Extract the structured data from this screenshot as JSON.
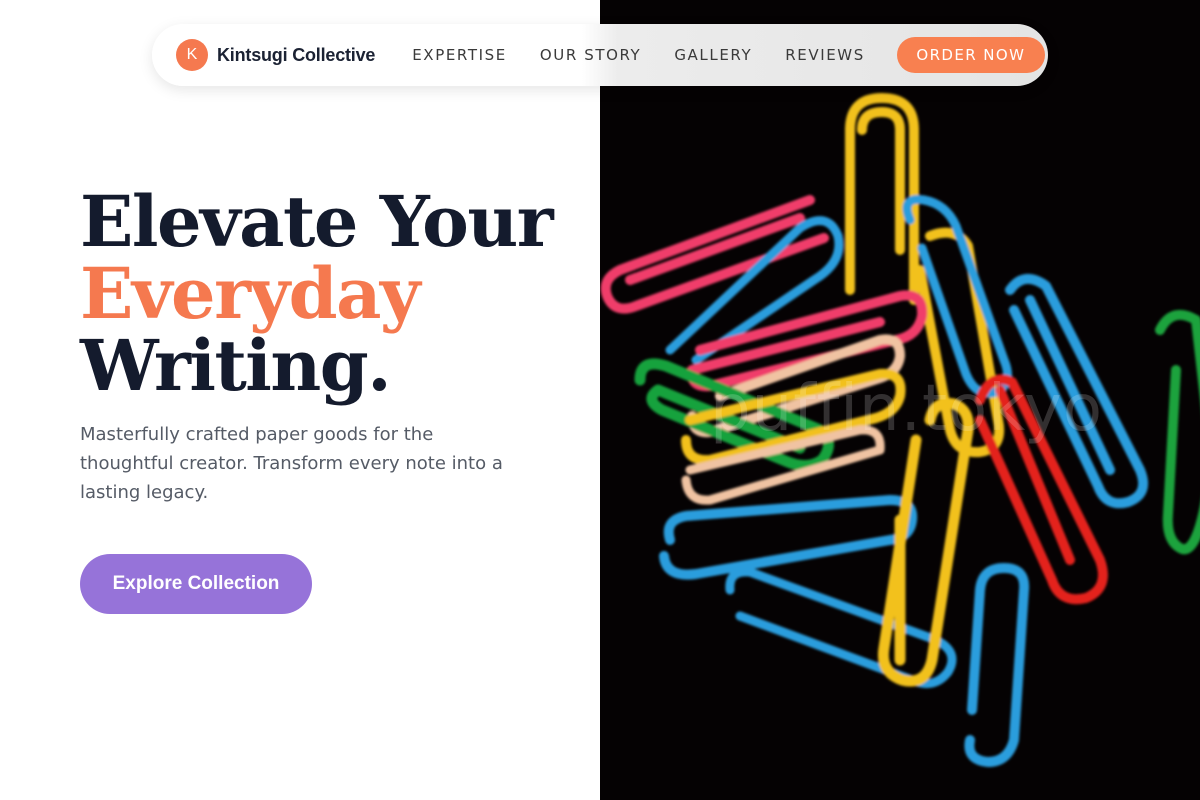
{
  "nav": {
    "brand_initial": "K",
    "brand_name": "Kintsugi Collective",
    "links": [
      {
        "label": "EXPERTISE"
      },
      {
        "label": "OUR STORY"
      },
      {
        "label": "GALLERY"
      },
      {
        "label": "REVIEWS"
      }
    ],
    "cta_label": "ORDER NOW"
  },
  "hero": {
    "headline_line1": "Elevate Your",
    "headline_line2": "Everyday",
    "headline_line3": "Writing.",
    "subtitle": "Masterfully crafted paper goods for the thoughtful creator. Transform every note into a lasting legacy.",
    "cta_label": "Explore Collection"
  },
  "image": {
    "watermark": "puffin.tokyo"
  },
  "colors": {
    "accent_orange": "#f5794f",
    "button_purple": "#9673d9",
    "headline_navy": "#141b2d"
  }
}
